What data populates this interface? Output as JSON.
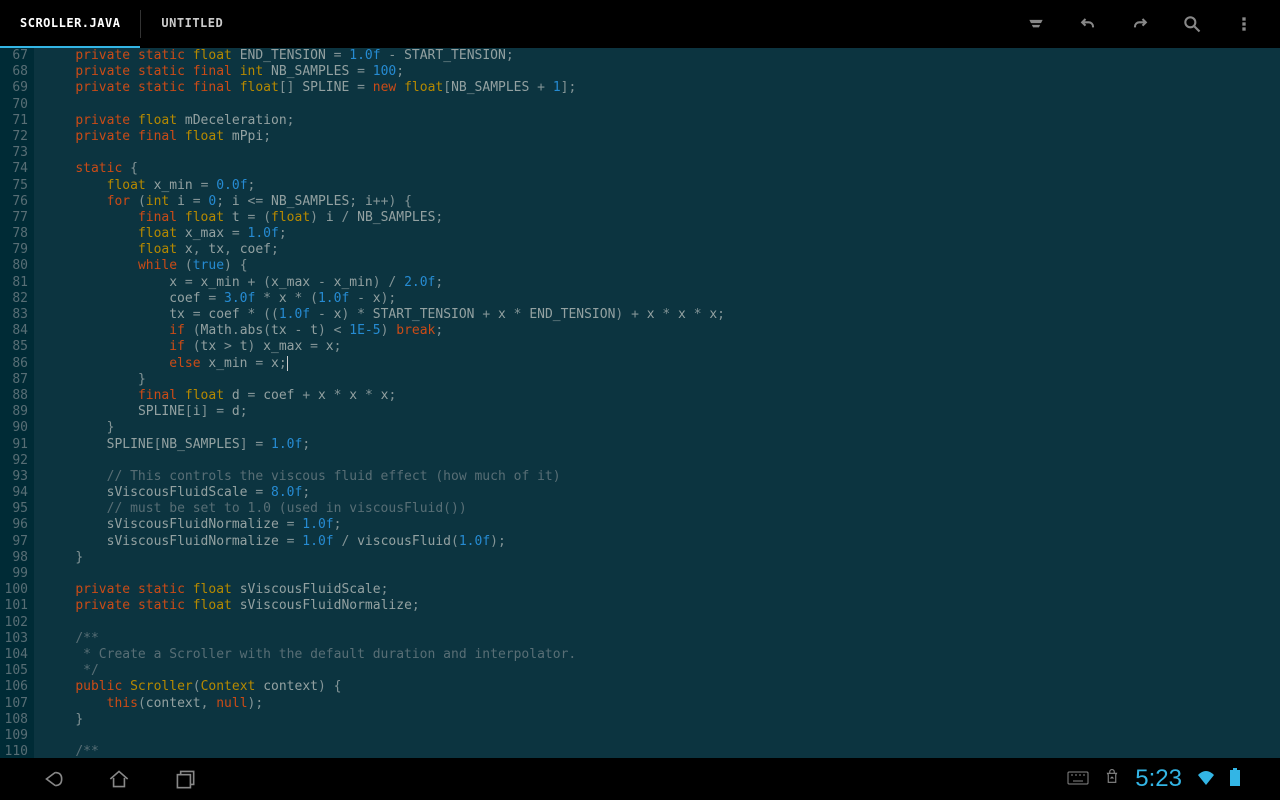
{
  "tabs": {
    "active": "SCROLLER.JAVA",
    "inactive": "UNTITLED"
  },
  "gutter": {
    "start": 67,
    "end": 110
  },
  "code": [
    [
      [
        "kw",
        "private"
      ],
      [
        "op",
        " "
      ],
      [
        "kw",
        "static"
      ],
      [
        "op",
        " "
      ],
      [
        "type",
        "float"
      ],
      [
        "op",
        " "
      ],
      [
        "const",
        "END_TENSION"
      ],
      [
        "op",
        " "
      ],
      [
        "punc",
        "="
      ],
      [
        "op",
        " "
      ],
      [
        "num",
        "1.0f"
      ],
      [
        "op",
        " "
      ],
      [
        "punc",
        "-"
      ],
      [
        "op",
        " "
      ],
      [
        "const",
        "START_TENSION"
      ],
      [
        "punc",
        ";"
      ]
    ],
    [
      [
        "kw",
        "private"
      ],
      [
        "op",
        " "
      ],
      [
        "kw",
        "static"
      ],
      [
        "op",
        " "
      ],
      [
        "kw",
        "final"
      ],
      [
        "op",
        " "
      ],
      [
        "type",
        "int"
      ],
      [
        "op",
        " "
      ],
      [
        "const",
        "NB_SAMPLES"
      ],
      [
        "op",
        " "
      ],
      [
        "punc",
        "="
      ],
      [
        "op",
        " "
      ],
      [
        "num",
        "100"
      ],
      [
        "punc",
        ";"
      ]
    ],
    [
      [
        "kw",
        "private"
      ],
      [
        "op",
        " "
      ],
      [
        "kw",
        "static"
      ],
      [
        "op",
        " "
      ],
      [
        "kw",
        "final"
      ],
      [
        "op",
        " "
      ],
      [
        "type",
        "float"
      ],
      [
        "punc",
        "[]"
      ],
      [
        "op",
        " "
      ],
      [
        "const",
        "SPLINE"
      ],
      [
        "op",
        " "
      ],
      [
        "punc",
        "="
      ],
      [
        "op",
        " "
      ],
      [
        "kw",
        "new"
      ],
      [
        "op",
        " "
      ],
      [
        "type",
        "float"
      ],
      [
        "punc",
        "["
      ],
      [
        "const",
        "NB_SAMPLES"
      ],
      [
        "op",
        " "
      ],
      [
        "punc",
        "+"
      ],
      [
        "op",
        " "
      ],
      [
        "num",
        "1"
      ],
      [
        "punc",
        "];"
      ]
    ],
    [],
    [
      [
        "kw",
        "private"
      ],
      [
        "op",
        " "
      ],
      [
        "type",
        "float"
      ],
      [
        "op",
        " "
      ],
      [
        "ident",
        "mDeceleration"
      ],
      [
        "punc",
        ";"
      ]
    ],
    [
      [
        "kw",
        "private"
      ],
      [
        "op",
        " "
      ],
      [
        "kw",
        "final"
      ],
      [
        "op",
        " "
      ],
      [
        "type",
        "float"
      ],
      [
        "op",
        " "
      ],
      [
        "ident",
        "mPpi"
      ],
      [
        "punc",
        ";"
      ]
    ],
    [],
    [
      [
        "kw",
        "static"
      ],
      [
        "op",
        " "
      ],
      [
        "punc",
        "{"
      ]
    ],
    [
      [
        "op",
        "    "
      ],
      [
        "type",
        "float"
      ],
      [
        "op",
        " "
      ],
      [
        "ident",
        "x_min"
      ],
      [
        "op",
        " "
      ],
      [
        "punc",
        "="
      ],
      [
        "op",
        " "
      ],
      [
        "num",
        "0.0f"
      ],
      [
        "punc",
        ";"
      ]
    ],
    [
      [
        "op",
        "    "
      ],
      [
        "kw",
        "for"
      ],
      [
        "op",
        " "
      ],
      [
        "punc",
        "("
      ],
      [
        "type",
        "int"
      ],
      [
        "op",
        " "
      ],
      [
        "ident",
        "i"
      ],
      [
        "op",
        " "
      ],
      [
        "punc",
        "="
      ],
      [
        "op",
        " "
      ],
      [
        "num",
        "0"
      ],
      [
        "punc",
        ";"
      ],
      [
        "op",
        " "
      ],
      [
        "ident",
        "i"
      ],
      [
        "op",
        " "
      ],
      [
        "punc",
        "<="
      ],
      [
        "op",
        " "
      ],
      [
        "const",
        "NB_SAMPLES"
      ],
      [
        "punc",
        ";"
      ],
      [
        "op",
        " "
      ],
      [
        "ident",
        "i"
      ],
      [
        "punc",
        "++"
      ],
      [
        "punc",
        ")"
      ],
      [
        "op",
        " "
      ],
      [
        "punc",
        "{"
      ]
    ],
    [
      [
        "op",
        "        "
      ],
      [
        "kw",
        "final"
      ],
      [
        "op",
        " "
      ],
      [
        "type",
        "float"
      ],
      [
        "op",
        " "
      ],
      [
        "ident",
        "t"
      ],
      [
        "op",
        " "
      ],
      [
        "punc",
        "="
      ],
      [
        "op",
        " "
      ],
      [
        "punc",
        "("
      ],
      [
        "type",
        "float"
      ],
      [
        "punc",
        ")"
      ],
      [
        "op",
        " "
      ],
      [
        "ident",
        "i"
      ],
      [
        "op",
        " "
      ],
      [
        "punc",
        "/"
      ],
      [
        "op",
        " "
      ],
      [
        "const",
        "NB_SAMPLES"
      ],
      [
        "punc",
        ";"
      ]
    ],
    [
      [
        "op",
        "        "
      ],
      [
        "type",
        "float"
      ],
      [
        "op",
        " "
      ],
      [
        "ident",
        "x_max"
      ],
      [
        "op",
        " "
      ],
      [
        "punc",
        "="
      ],
      [
        "op",
        " "
      ],
      [
        "num",
        "1.0f"
      ],
      [
        "punc",
        ";"
      ]
    ],
    [
      [
        "op",
        "        "
      ],
      [
        "type",
        "float"
      ],
      [
        "op",
        " "
      ],
      [
        "ident",
        "x"
      ],
      [
        "punc",
        ","
      ],
      [
        "op",
        " "
      ],
      [
        "ident",
        "tx"
      ],
      [
        "punc",
        ","
      ],
      [
        "op",
        " "
      ],
      [
        "ident",
        "coef"
      ],
      [
        "punc",
        ";"
      ]
    ],
    [
      [
        "op",
        "        "
      ],
      [
        "kw",
        "while"
      ],
      [
        "op",
        " "
      ],
      [
        "punc",
        "("
      ],
      [
        "bool",
        "true"
      ],
      [
        "punc",
        ")"
      ],
      [
        "op",
        " "
      ],
      [
        "punc",
        "{"
      ]
    ],
    [
      [
        "op",
        "            "
      ],
      [
        "ident",
        "x"
      ],
      [
        "op",
        " "
      ],
      [
        "punc",
        "="
      ],
      [
        "op",
        " "
      ],
      [
        "ident",
        "x_min"
      ],
      [
        "op",
        " "
      ],
      [
        "punc",
        "+"
      ],
      [
        "op",
        " "
      ],
      [
        "punc",
        "("
      ],
      [
        "ident",
        "x_max"
      ],
      [
        "op",
        " "
      ],
      [
        "punc",
        "-"
      ],
      [
        "op",
        " "
      ],
      [
        "ident",
        "x_min"
      ],
      [
        "punc",
        ")"
      ],
      [
        "op",
        " "
      ],
      [
        "punc",
        "/"
      ],
      [
        "op",
        " "
      ],
      [
        "num",
        "2.0f"
      ],
      [
        "punc",
        ";"
      ]
    ],
    [
      [
        "op",
        "            "
      ],
      [
        "ident",
        "coef"
      ],
      [
        "op",
        " "
      ],
      [
        "punc",
        "="
      ],
      [
        "op",
        " "
      ],
      [
        "num",
        "3.0f"
      ],
      [
        "op",
        " "
      ],
      [
        "punc",
        "*"
      ],
      [
        "op",
        " "
      ],
      [
        "ident",
        "x"
      ],
      [
        "op",
        " "
      ],
      [
        "punc",
        "*"
      ],
      [
        "op",
        " "
      ],
      [
        "punc",
        "("
      ],
      [
        "num",
        "1.0f"
      ],
      [
        "op",
        " "
      ],
      [
        "punc",
        "-"
      ],
      [
        "op",
        " "
      ],
      [
        "ident",
        "x"
      ],
      [
        "punc",
        ");"
      ]
    ],
    [
      [
        "op",
        "            "
      ],
      [
        "ident",
        "tx"
      ],
      [
        "op",
        " "
      ],
      [
        "punc",
        "="
      ],
      [
        "op",
        " "
      ],
      [
        "ident",
        "coef"
      ],
      [
        "op",
        " "
      ],
      [
        "punc",
        "*"
      ],
      [
        "op",
        " "
      ],
      [
        "punc",
        "(("
      ],
      [
        "num",
        "1.0f"
      ],
      [
        "op",
        " "
      ],
      [
        "punc",
        "-"
      ],
      [
        "op",
        " "
      ],
      [
        "ident",
        "x"
      ],
      [
        "punc",
        ")"
      ],
      [
        "op",
        " "
      ],
      [
        "punc",
        "*"
      ],
      [
        "op",
        " "
      ],
      [
        "const",
        "START_TENSION"
      ],
      [
        "op",
        " "
      ],
      [
        "punc",
        "+"
      ],
      [
        "op",
        " "
      ],
      [
        "ident",
        "x"
      ],
      [
        "op",
        " "
      ],
      [
        "punc",
        "*"
      ],
      [
        "op",
        " "
      ],
      [
        "const",
        "END_TENSION"
      ],
      [
        "punc",
        ")"
      ],
      [
        "op",
        " "
      ],
      [
        "punc",
        "+"
      ],
      [
        "op",
        " "
      ],
      [
        "ident",
        "x"
      ],
      [
        "op",
        " "
      ],
      [
        "punc",
        "*"
      ],
      [
        "op",
        " "
      ],
      [
        "ident",
        "x"
      ],
      [
        "op",
        " "
      ],
      [
        "punc",
        "*"
      ],
      [
        "op",
        " "
      ],
      [
        "ident",
        "x"
      ],
      [
        "punc",
        ";"
      ]
    ],
    [
      [
        "op",
        "            "
      ],
      [
        "kw",
        "if"
      ],
      [
        "op",
        " "
      ],
      [
        "punc",
        "("
      ],
      [
        "ident",
        "Math"
      ],
      [
        "punc",
        "."
      ],
      [
        "ident",
        "abs"
      ],
      [
        "punc",
        "("
      ],
      [
        "ident",
        "tx"
      ],
      [
        "op",
        " "
      ],
      [
        "punc",
        "-"
      ],
      [
        "op",
        " "
      ],
      [
        "ident",
        "t"
      ],
      [
        "punc",
        ")"
      ],
      [
        "op",
        " "
      ],
      [
        "punc",
        "<"
      ],
      [
        "op",
        " "
      ],
      [
        "num",
        "1E-5"
      ],
      [
        "punc",
        ")"
      ],
      [
        "op",
        " "
      ],
      [
        "kw",
        "break"
      ],
      [
        "punc",
        ";"
      ]
    ],
    [
      [
        "op",
        "            "
      ],
      [
        "kw",
        "if"
      ],
      [
        "op",
        " "
      ],
      [
        "punc",
        "("
      ],
      [
        "ident",
        "tx"
      ],
      [
        "op",
        " "
      ],
      [
        "punc",
        ">"
      ],
      [
        "op",
        " "
      ],
      [
        "ident",
        "t"
      ],
      [
        "punc",
        ")"
      ],
      [
        "op",
        " "
      ],
      [
        "ident",
        "x_max"
      ],
      [
        "op",
        " "
      ],
      [
        "punc",
        "="
      ],
      [
        "op",
        " "
      ],
      [
        "ident",
        "x"
      ],
      [
        "punc",
        ";"
      ]
    ],
    [
      [
        "op",
        "            "
      ],
      [
        "kw",
        "else"
      ],
      [
        "op",
        " "
      ],
      [
        "ident",
        "x_min"
      ],
      [
        "op",
        " "
      ],
      [
        "punc",
        "="
      ],
      [
        "op",
        " "
      ],
      [
        "ident",
        "x"
      ],
      [
        "punc",
        ";"
      ],
      [
        "cursor",
        ""
      ]
    ],
    [
      [
        "op",
        "        "
      ],
      [
        "punc",
        "}"
      ]
    ],
    [
      [
        "op",
        "        "
      ],
      [
        "kw",
        "final"
      ],
      [
        "op",
        " "
      ],
      [
        "type",
        "float"
      ],
      [
        "op",
        " "
      ],
      [
        "ident",
        "d"
      ],
      [
        "op",
        " "
      ],
      [
        "punc",
        "="
      ],
      [
        "op",
        " "
      ],
      [
        "ident",
        "coef"
      ],
      [
        "op",
        " "
      ],
      [
        "punc",
        "+"
      ],
      [
        "op",
        " "
      ],
      [
        "ident",
        "x"
      ],
      [
        "op",
        " "
      ],
      [
        "punc",
        "*"
      ],
      [
        "op",
        " "
      ],
      [
        "ident",
        "x"
      ],
      [
        "op",
        " "
      ],
      [
        "punc",
        "*"
      ],
      [
        "op",
        " "
      ],
      [
        "ident",
        "x"
      ],
      [
        "punc",
        ";"
      ]
    ],
    [
      [
        "op",
        "        "
      ],
      [
        "const",
        "SPLINE"
      ],
      [
        "punc",
        "["
      ],
      [
        "ident",
        "i"
      ],
      [
        "punc",
        "]"
      ],
      [
        "op",
        " "
      ],
      [
        "punc",
        "="
      ],
      [
        "op",
        " "
      ],
      [
        "ident",
        "d"
      ],
      [
        "punc",
        ";"
      ]
    ],
    [
      [
        "op",
        "    "
      ],
      [
        "punc",
        "}"
      ]
    ],
    [
      [
        "op",
        "    "
      ],
      [
        "const",
        "SPLINE"
      ],
      [
        "punc",
        "["
      ],
      [
        "const",
        "NB_SAMPLES"
      ],
      [
        "punc",
        "]"
      ],
      [
        "op",
        " "
      ],
      [
        "punc",
        "="
      ],
      [
        "op",
        " "
      ],
      [
        "num",
        "1.0f"
      ],
      [
        "punc",
        ";"
      ]
    ],
    [],
    [
      [
        "op",
        "    "
      ],
      [
        "com",
        "// This controls the viscous fluid effect (how much of it)"
      ]
    ],
    [
      [
        "op",
        "    "
      ],
      [
        "ident",
        "sViscousFluidScale"
      ],
      [
        "op",
        " "
      ],
      [
        "punc",
        "="
      ],
      [
        "op",
        " "
      ],
      [
        "num",
        "8.0f"
      ],
      [
        "punc",
        ";"
      ]
    ],
    [
      [
        "op",
        "    "
      ],
      [
        "com",
        "// must be set to 1.0 (used in viscousFluid())"
      ]
    ],
    [
      [
        "op",
        "    "
      ],
      [
        "ident",
        "sViscousFluidNormalize"
      ],
      [
        "op",
        " "
      ],
      [
        "punc",
        "="
      ],
      [
        "op",
        " "
      ],
      [
        "num",
        "1.0f"
      ],
      [
        "punc",
        ";"
      ]
    ],
    [
      [
        "op",
        "    "
      ],
      [
        "ident",
        "sViscousFluidNormalize"
      ],
      [
        "op",
        " "
      ],
      [
        "punc",
        "="
      ],
      [
        "op",
        " "
      ],
      [
        "num",
        "1.0f"
      ],
      [
        "op",
        " "
      ],
      [
        "punc",
        "/"
      ],
      [
        "op",
        " "
      ],
      [
        "ident",
        "viscousFluid"
      ],
      [
        "punc",
        "("
      ],
      [
        "num",
        "1.0f"
      ],
      [
        "punc",
        ");"
      ]
    ],
    [
      [
        "punc",
        "}"
      ]
    ],
    [],
    [
      [
        "kw",
        "private"
      ],
      [
        "op",
        " "
      ],
      [
        "kw",
        "static"
      ],
      [
        "op",
        " "
      ],
      [
        "type",
        "float"
      ],
      [
        "op",
        " "
      ],
      [
        "ident",
        "sViscousFluidScale"
      ],
      [
        "punc",
        ";"
      ]
    ],
    [
      [
        "kw",
        "private"
      ],
      [
        "op",
        " "
      ],
      [
        "kw",
        "static"
      ],
      [
        "op",
        " "
      ],
      [
        "type",
        "float"
      ],
      [
        "op",
        " "
      ],
      [
        "ident",
        "sViscousFluidNormalize"
      ],
      [
        "punc",
        ";"
      ]
    ],
    [],
    [
      [
        "com",
        "/**"
      ]
    ],
    [
      [
        "com",
        " * Create a Scroller with the default duration and interpolator."
      ]
    ],
    [
      [
        "com",
        " */"
      ]
    ],
    [
      [
        "kw",
        "public"
      ],
      [
        "op",
        " "
      ],
      [
        "type",
        "Scroller"
      ],
      [
        "punc",
        "("
      ],
      [
        "type",
        "Context"
      ],
      [
        "op",
        " "
      ],
      [
        "ident",
        "context"
      ],
      [
        "punc",
        ")"
      ],
      [
        "op",
        " "
      ],
      [
        "punc",
        "{"
      ]
    ],
    [
      [
        "op",
        "    "
      ],
      [
        "kw",
        "this"
      ],
      [
        "punc",
        "("
      ],
      [
        "ident",
        "context"
      ],
      [
        "punc",
        ","
      ],
      [
        "op",
        " "
      ],
      [
        "kw",
        "null"
      ],
      [
        "punc",
        ");"
      ]
    ],
    [
      [
        "punc",
        "}"
      ]
    ],
    [],
    [
      [
        "com",
        "/**"
      ]
    ]
  ],
  "indent": "    ",
  "status": {
    "time": "5:23"
  }
}
